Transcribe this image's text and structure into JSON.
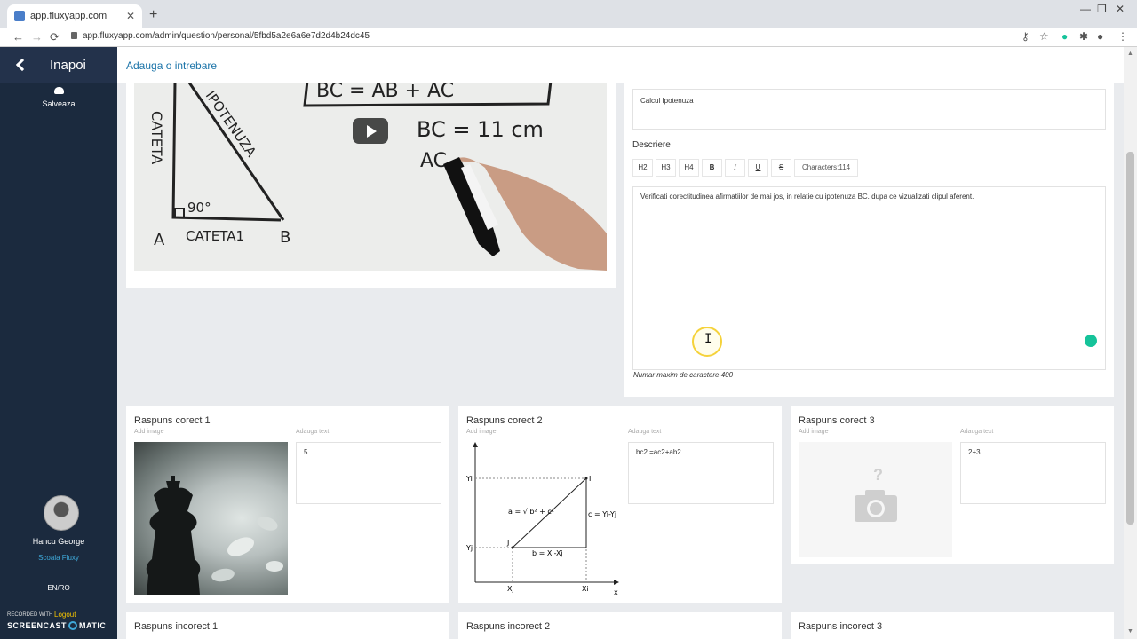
{
  "browser": {
    "tab_title": "app.fluxyapp.com",
    "tab_close": "✕",
    "new_tab": "+",
    "url": "app.fluxyapp.com/admin/question/personal/5fbd5a2e6a6e7d2d4b24dc45"
  },
  "sidebar": {
    "back_label": "Inapoi",
    "save_label": "Salveaza",
    "user_name": "Hancu George",
    "school": "Scoala Fluxy",
    "lang_en": "EN",
    "lang_sep": "/",
    "lang_ro": "RO",
    "logout": "Logout",
    "recorded_with": "RECORDED WITH",
    "screencast_left": "SCREENCAST",
    "screencast_right": "MATIC"
  },
  "header": {
    "title": "Adauga o intrebare"
  },
  "video": {
    "board_top": "BC = AB + AC",
    "board_eq": "BC = 11 cm",
    "board_ac": "AC",
    "board_ipotenuza": "IPOTENUZA",
    "board_angle": "90°",
    "board_a": "A",
    "board_catetal": "CATETA1",
    "board_b": "B"
  },
  "form": {
    "title_value": "Calcul Ipotenuza",
    "desc_label": "Descriere",
    "toolbar": [
      "H2",
      "H3",
      "H4",
      "B",
      "I",
      "U",
      "S"
    ],
    "char_count": "Characters:114",
    "desc_value": "Verificati corectitudinea afirmatiilor de mai jos, in relatie cu ipotenuza BC. dupa ce vizualizati clipul aferent.",
    "max_chars": "Numar maxim de caractere 400"
  },
  "answers": {
    "add_image": "Add image",
    "add_text": "Adauga text",
    "correct": [
      {
        "title": "Raspuns corect 1",
        "text": "5"
      },
      {
        "title": "Raspuns corect 2",
        "text": "bc2 =ac2+ab2"
      },
      {
        "title": "Raspuns corect 3",
        "text": "2+3"
      }
    ],
    "incorrect": [
      {
        "title": "Raspuns incorect 1"
      },
      {
        "title": "Raspuns incorect 2"
      },
      {
        "title": "Raspuns incorect 3"
      }
    ]
  },
  "diagram": {
    "yi": "Yi",
    "yj": "Yj",
    "xj": "Xj",
    "xi": "Xi",
    "x": "x",
    "i": "I",
    "j": "J",
    "a_formula": "a = √ b² + c²",
    "c_label": "c = Yi-Yj",
    "b_label": "b = Xi-Xj"
  }
}
